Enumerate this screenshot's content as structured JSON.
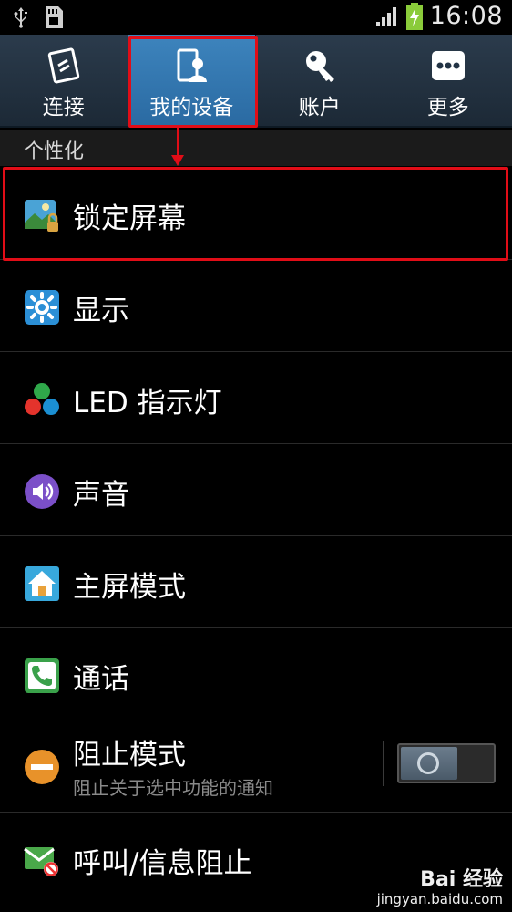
{
  "status_bar": {
    "time": "16:08"
  },
  "tabs": [
    {
      "label": "连接",
      "icon": "connections-icon",
      "active": false
    },
    {
      "label": "我的设备",
      "icon": "my-device-icon",
      "active": true
    },
    {
      "label": "账户",
      "icon": "accounts-icon",
      "active": false
    },
    {
      "label": "更多",
      "icon": "more-icon",
      "active": false
    }
  ],
  "section": {
    "title": "个性化"
  },
  "items": [
    {
      "title": "锁定屏幕",
      "icon": "lock-screen-icon"
    },
    {
      "title": "显示",
      "icon": "display-icon"
    },
    {
      "title": "LED 指示灯",
      "icon": "led-indicator-icon"
    },
    {
      "title": "声音",
      "icon": "sound-icon"
    },
    {
      "title": "主屏模式",
      "icon": "home-screen-mode-icon"
    },
    {
      "title": "通话",
      "icon": "call-icon"
    },
    {
      "title": "阻止模式",
      "subtitle": "阻止关于选中功能的通知",
      "icon": "blocking-mode-icon",
      "toggle": "off"
    },
    {
      "title": "呼叫/信息阻止",
      "icon": "call-message-block-icon"
    }
  ],
  "watermark": {
    "brand": "Bai 经验",
    "url": "jingyan.baidu.com"
  },
  "colors": {
    "accent_tab": "#3d84bd",
    "highlight": "#e10d17"
  }
}
